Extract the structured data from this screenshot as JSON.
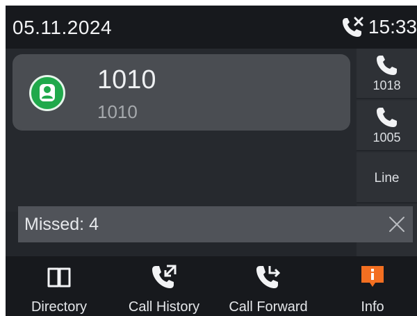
{
  "status_bar": {
    "date": "05.11.2024",
    "time": "15:33",
    "missed_call_icon": "missed-call-icon"
  },
  "active_call": {
    "name": "1010",
    "number": "1010",
    "avatar_icon": "contact-avatar-icon",
    "avatar_color": "#20a94b"
  },
  "line_keys": [
    {
      "label": "1018",
      "icon": "phone-icon"
    },
    {
      "label": "1005",
      "icon": "phone-icon"
    },
    {
      "label": "Line",
      "icon": ""
    }
  ],
  "missed_banner": {
    "text": "Missed: 4",
    "close_icon": "close-icon"
  },
  "softkeys": [
    {
      "label": "Directory",
      "icon": "book-icon"
    },
    {
      "label": "Call History",
      "icon": "call-history-icon"
    },
    {
      "label": "Call Forward",
      "icon": "call-forward-icon"
    },
    {
      "label": "Info",
      "icon": "info-icon",
      "accent": "#f36f21"
    }
  ]
}
